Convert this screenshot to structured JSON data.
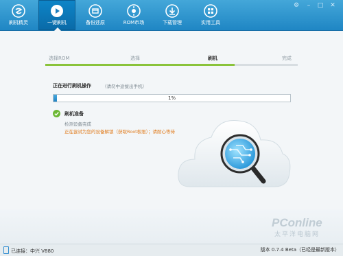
{
  "toolbar": {
    "items": [
      {
        "label": "刷机精灵",
        "icon": "logo-icon"
      },
      {
        "label": "一键刷机",
        "icon": "play-icon",
        "active": true
      },
      {
        "label": "备份还原",
        "icon": "backup-icon"
      },
      {
        "label": "ROM市场",
        "icon": "rom-market-icon"
      },
      {
        "label": "下载管理",
        "icon": "download-icon"
      },
      {
        "label": "实用工具",
        "icon": "tools-icon"
      }
    ],
    "window_controls": [
      "settings-icon",
      "minimize-icon",
      "maximize-icon",
      "close-icon"
    ]
  },
  "steps": {
    "items": [
      "选择ROM",
      "选择",
      "刷机",
      "完成"
    ],
    "current_index": 2,
    "progress_fraction": 0.75
  },
  "flash": {
    "title": "正在进行刷机操作",
    "subtitle": "（请勿中途拔出手机）",
    "progress_text": "1%",
    "progress_value": 0.01
  },
  "prep": {
    "title": "刷机准备",
    "line1": "检测设备完成",
    "line2": "正在尝试为您的设备解锁（获取Root权限）；请耐心等待"
  },
  "statusbar": {
    "connection": "已连接：中兴 V880",
    "version": "版本 0.7.4 Beta（已经是最新版本）"
  },
  "watermark": {
    "text": "PConline",
    "subtext": "太平洋电脑网"
  },
  "colors": {
    "toolbar": "#2a90cc",
    "accent_green": "#8ac33b",
    "warning_orange": "#e07a1a",
    "progress_blue": "#2a8ccc"
  }
}
